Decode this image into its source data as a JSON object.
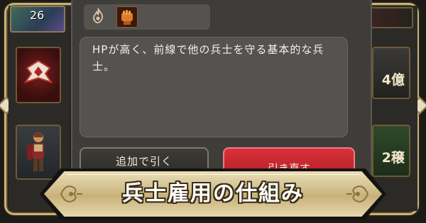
{
  "hero": {
    "level": "26"
  },
  "modal": {
    "description": "HPが高く、前線で他の兵士を守る基本的な兵士。",
    "add_button_label": "追加で引く",
    "redraw_button_label": "引き直す"
  },
  "right_panel": {
    "tile1_label": "4億",
    "tile2_label": "2穣"
  },
  "banner": {
    "title": "兵士雇用の仕組み"
  },
  "icons": [
    "flame-icon",
    "fist-icon",
    "emblem-icon",
    "soldier-portrait-icon",
    "ornament-icon"
  ],
  "colors": {
    "frame_gold": "#c9b27a",
    "redraw_red": "#c62630",
    "banner_cream": "#e6d8ae"
  }
}
